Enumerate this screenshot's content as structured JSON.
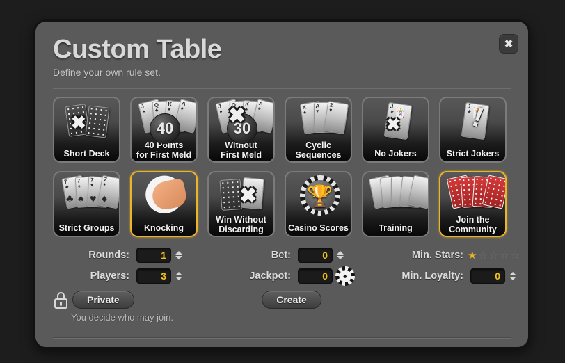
{
  "dialog": {
    "title": "Custom Table",
    "subtitle": "Define your own rule set.",
    "close_label": "✖"
  },
  "tiles": [
    {
      "label": "Short Deck",
      "art": "two-cards-x",
      "selected": false
    },
    {
      "label": "40 Points\nfor First Meld",
      "art": "fan-badge-40",
      "selected": false,
      "badge": "40"
    },
    {
      "label": "Without\nFirst Meld",
      "art": "fan-badge-30-x",
      "selected": false,
      "badge": "30"
    },
    {
      "label": "Cyclic\nSequences",
      "art": "fan-k-a-2",
      "selected": false
    },
    {
      "label": "No Jokers",
      "art": "joker-x",
      "selected": false
    },
    {
      "label": "Strict Jokers",
      "art": "joker-bang",
      "selected": false
    },
    {
      "label": "Strict Groups",
      "art": "four-sevens",
      "selected": false
    },
    {
      "label": "Knocking",
      "art": "knocking-hand",
      "selected": true
    },
    {
      "label": "Win Without\nDiscarding",
      "art": "card-back-x",
      "selected": false
    },
    {
      "label": "Casino Scores",
      "art": "trophy-chip",
      "selected": false
    },
    {
      "label": "Training",
      "art": "blank-fan",
      "selected": false
    },
    {
      "label": "Join the\nCommunity",
      "art": "red-card-fan",
      "selected": true
    }
  ],
  "tile_art_text": {
    "fan_ranks": [
      "J",
      "Q",
      "K",
      "A"
    ],
    "cyclic_ranks": [
      "K",
      "A",
      "2"
    ],
    "seven_rank": "7",
    "joker_rank": "J",
    "suits": [
      "♣",
      "♠",
      "♥",
      "♦"
    ]
  },
  "controls": {
    "rounds": {
      "label": "Rounds:",
      "value": "1"
    },
    "players": {
      "label": "Players:",
      "value": "3"
    },
    "bet": {
      "label": "Bet:",
      "value": "0"
    },
    "jackpot": {
      "label": "Jackpot:",
      "value": "0"
    },
    "min_stars": {
      "label": "Min. Stars:",
      "value": 1,
      "max": 5
    },
    "min_loyalty": {
      "label": "Min. Loyalty:",
      "value": "0"
    }
  },
  "footer": {
    "private_label": "Private",
    "create_label": "Create",
    "hint": "You decide who may join."
  },
  "colors": {
    "accent": "#f0c21e",
    "selected_border": "#ecb42b",
    "panel": "#5a5a5a",
    "backdrop": "#1d1d1d",
    "star_on": "#e8b325"
  }
}
